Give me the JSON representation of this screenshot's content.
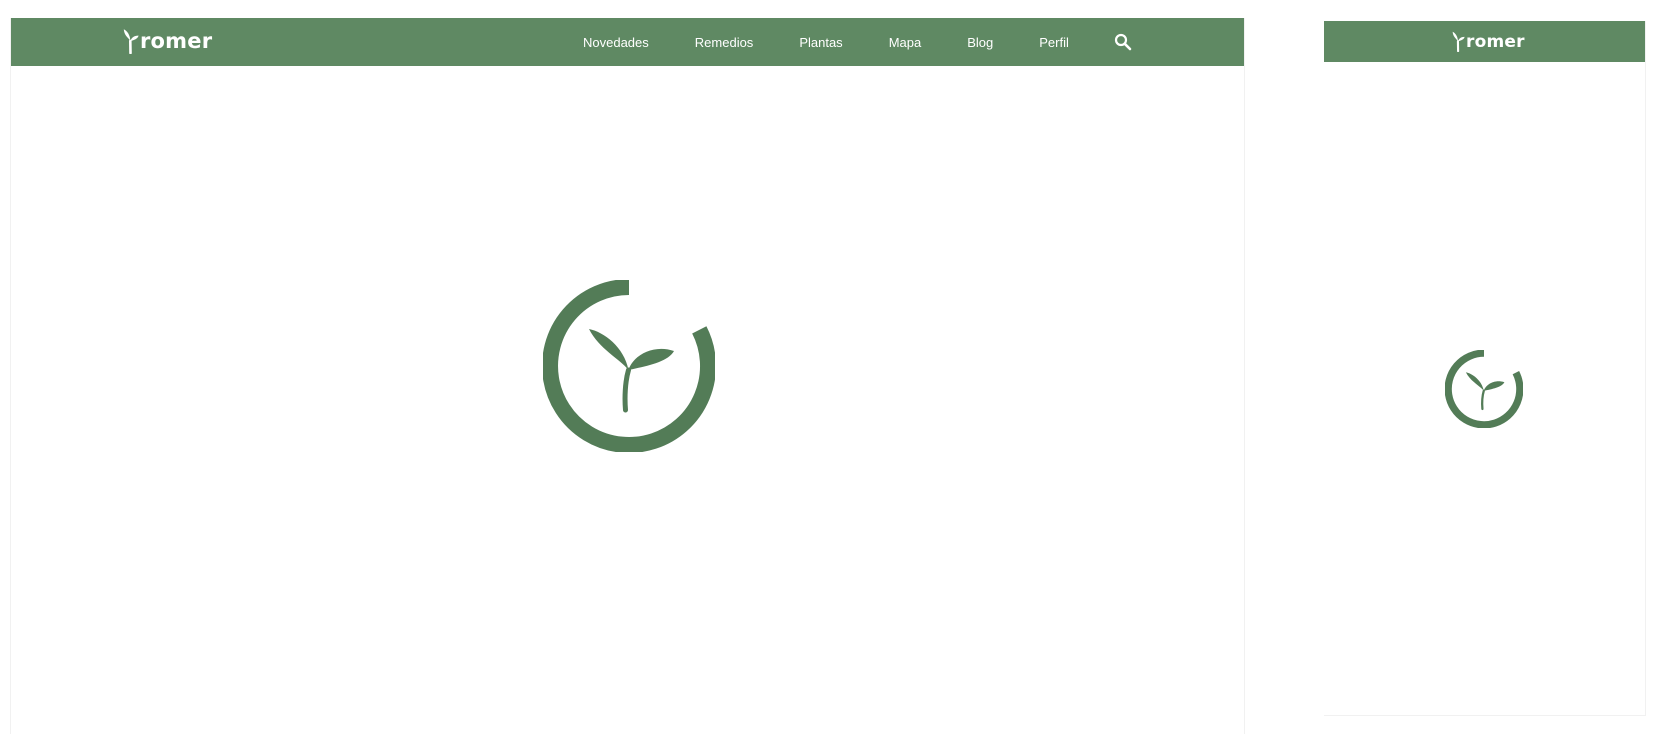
{
  "brand": {
    "name": "romer",
    "logo_icon": "sprout-icon"
  },
  "nav": {
    "items": [
      {
        "label": "Novedades"
      },
      {
        "label": "Remedios"
      },
      {
        "label": "Plantas"
      },
      {
        "label": "Mapa"
      },
      {
        "label": "Blog"
      },
      {
        "label": "Perfil"
      }
    ],
    "search_icon": "search-icon"
  },
  "loader": {
    "icon": "sprout-spinner-icon"
  },
  "colors": {
    "header_bg": "#5f8963",
    "accent": "#537c57",
    "text_on_header": "#ffffff",
    "page_bg": "#ffffff"
  }
}
